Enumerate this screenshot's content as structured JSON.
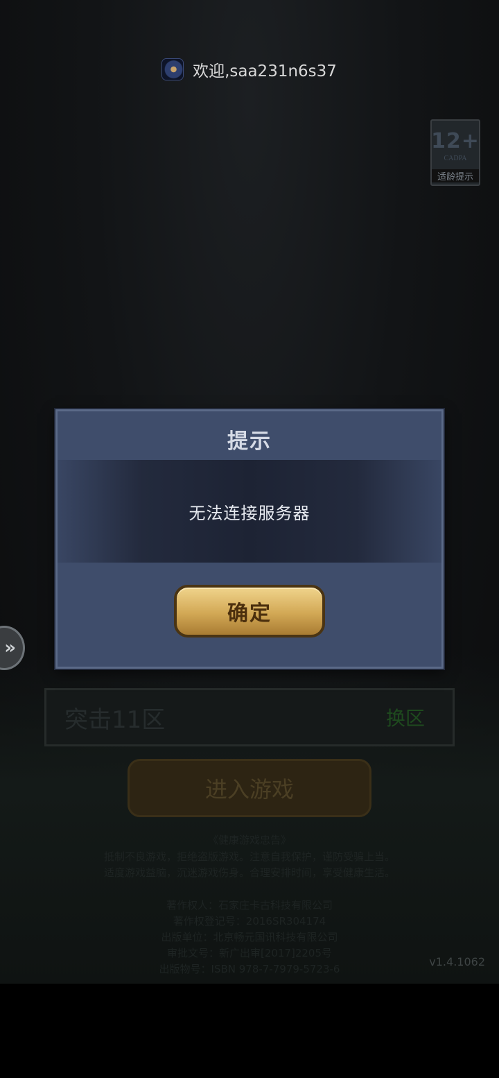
{
  "header": {
    "welcome_text": "欢迎,saa231n6s37",
    "avatar_icon": "game-avatar-icon"
  },
  "age_rating": {
    "label": "12+",
    "org": "CADPA",
    "tip": "适龄提示"
  },
  "side_handle": {
    "icon": "double-chevron-right-icon",
    "glyph": "»"
  },
  "server": {
    "name": "突击11区",
    "switch_label": "换区"
  },
  "enter_button": {
    "label": "进入游戏"
  },
  "notice": {
    "title": "《健康游戏忠告》",
    "line1": "抵制不良游戏，拒绝盗版游戏。注意自我保护，谨防受骗上当。",
    "line2": "适度游戏益脑，沉迷游戏伤身。合理安排时间，享受健康生活。",
    "copyright": "著作权人：石家庄卡古科技有限公司",
    "reg_no": "著作权登记号：2016SR304174",
    "publisher": "出版单位：北京畅元国讯科技有限公司",
    "approval": "审批文号：新广出审[2017]2205号",
    "isbn": "出版物号：ISBN 978-7-7979-5723-6"
  },
  "version": "v1.4.1062",
  "dialog": {
    "title": "提示",
    "message": "无法连接服务器",
    "ok_label": "确定"
  },
  "colors": {
    "dialog_bg": "#3f4d6b",
    "ok_button": "#d2a855",
    "switch_green": "#1e4a1e"
  }
}
